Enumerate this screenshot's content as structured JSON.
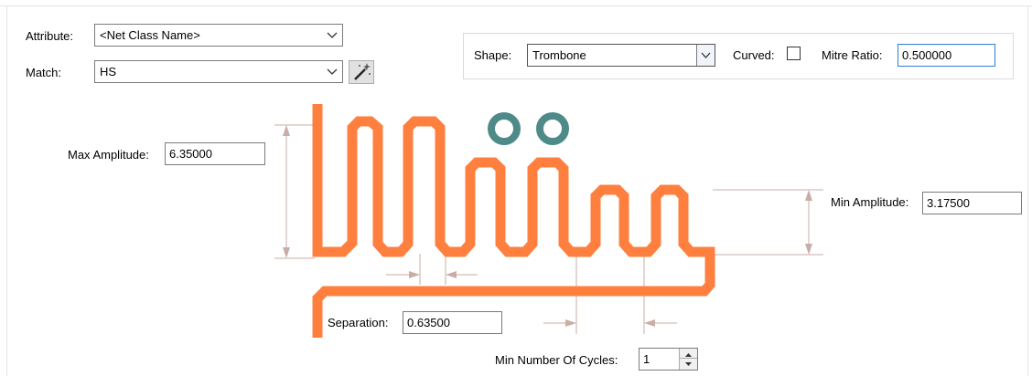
{
  "rule": {
    "attribute_label": "Attribute:",
    "attribute_value": "<Net Class Name>",
    "match_label": "Match:",
    "match_value": "HS"
  },
  "shape_group": {
    "shape_label": "Shape:",
    "shape_value": "Trombone",
    "curved_label": "Curved:",
    "curved_checked": false,
    "mitre_label": "Mitre Ratio:",
    "mitre_value": "0.500000"
  },
  "parameters": {
    "max_amplitude_label": "Max Amplitude:",
    "max_amplitude_value": "6.35000",
    "min_amplitude_label": "Min Amplitude:",
    "min_amplitude_value": "3.17500",
    "separation_label": "Separation:",
    "separation_value": "0.63500",
    "min_cycles_label": "Min Number Of Cycles:",
    "min_cycles_value": "1"
  },
  "colors": {
    "trace": "#ff7f3f",
    "via": "#4e8a87",
    "dimension": "#c8aea6",
    "input_focus_border": "#2f7dd1"
  },
  "icons": [
    "chevron-down-icon",
    "magic-wand-icon",
    "spin-up-icon",
    "spin-down-icon"
  ]
}
